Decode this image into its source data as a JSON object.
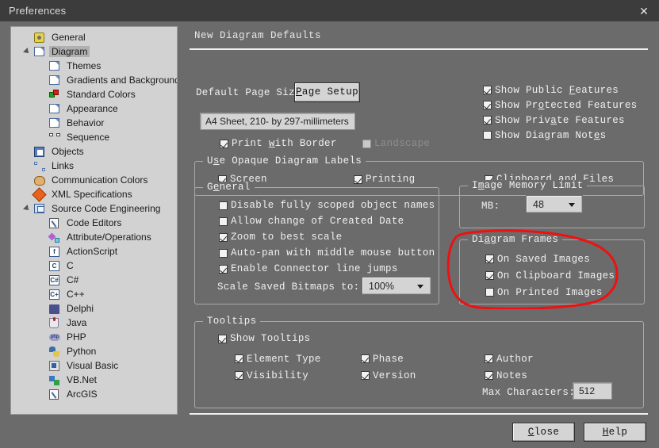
{
  "window": {
    "title": "Preferences",
    "close_icon": "close-icon"
  },
  "sidebar": {
    "items": [
      {
        "label": "General",
        "indent": 0,
        "icon": "gear-icon",
        "selected": false,
        "twisty": "none"
      },
      {
        "label": "Diagram",
        "indent": 0,
        "icon": "document-icon",
        "selected": true,
        "twisty": "open"
      },
      {
        "label": "Themes",
        "indent": 1,
        "icon": "document-icon",
        "selected": false,
        "twisty": "none"
      },
      {
        "label": "Gradients and Background",
        "indent": 1,
        "icon": "document-icon",
        "selected": false,
        "twisty": "none"
      },
      {
        "label": "Standard Colors",
        "indent": 1,
        "icon": "colors-icon",
        "selected": false,
        "twisty": "none"
      },
      {
        "label": "Appearance",
        "indent": 1,
        "icon": "document-icon",
        "selected": false,
        "twisty": "none"
      },
      {
        "label": "Behavior",
        "indent": 1,
        "icon": "document-icon",
        "selected": false,
        "twisty": "none"
      },
      {
        "label": "Sequence",
        "indent": 1,
        "icon": "sequence-icon",
        "selected": false,
        "twisty": "none"
      },
      {
        "label": "Objects",
        "indent": 0,
        "icon": "objects-icon",
        "selected": false,
        "twisty": "none"
      },
      {
        "label": "Links",
        "indent": 0,
        "icon": "links-icon",
        "selected": false,
        "twisty": "none"
      },
      {
        "label": "Communication Colors",
        "indent": 0,
        "icon": "palette-icon",
        "selected": false,
        "twisty": "none"
      },
      {
        "label": "XML Specifications",
        "indent": 0,
        "icon": "xml-icon",
        "selected": false,
        "twisty": "none"
      },
      {
        "label": "Source Code Engineering",
        "indent": 0,
        "icon": "stack-icon",
        "selected": false,
        "twisty": "open"
      },
      {
        "label": "Code Editors",
        "indent": 1,
        "icon": "edit-icon",
        "selected": false,
        "twisty": "none"
      },
      {
        "label": "Attribute/Operations",
        "indent": 1,
        "icon": "attribute-icon",
        "selected": false,
        "twisty": "none"
      },
      {
        "label": "ActionScript",
        "indent": 1,
        "icon": "actionscript-icon",
        "selected": false,
        "twisty": "none"
      },
      {
        "label": "C",
        "indent": 1,
        "icon": "c-icon",
        "selected": false,
        "twisty": "none"
      },
      {
        "label": "C#",
        "indent": 1,
        "icon": "csharp-icon",
        "selected": false,
        "twisty": "none"
      },
      {
        "label": "C++",
        "indent": 1,
        "icon": "cplusplus-icon",
        "selected": false,
        "twisty": "none"
      },
      {
        "label": "Delphi",
        "indent": 1,
        "icon": "delphi-icon",
        "selected": false,
        "twisty": "none"
      },
      {
        "label": "Java",
        "indent": 1,
        "icon": "java-icon",
        "selected": false,
        "twisty": "none"
      },
      {
        "label": "PHP",
        "indent": 1,
        "icon": "php-icon",
        "selected": false,
        "twisty": "none"
      },
      {
        "label": "Python",
        "indent": 1,
        "icon": "python-icon",
        "selected": false,
        "twisty": "none"
      },
      {
        "label": "Visual Basic",
        "indent": 1,
        "icon": "visualbasic-icon",
        "selected": false,
        "twisty": "none"
      },
      {
        "label": "VB.Net",
        "indent": 1,
        "icon": "vbnet-icon",
        "selected": false,
        "twisty": "none"
      },
      {
        "label": "ArcGIS",
        "indent": 1,
        "icon": "arcgis-icon",
        "selected": false,
        "twisty": "none"
      }
    ]
  },
  "panel": {
    "heading": "New Diagram Defaults",
    "page_size_label": "Default Page Size:",
    "page_setup_button": "Page Setup",
    "page_size_value": "A4 Sheet, 210- by 297-millimeters",
    "print_with_border": {
      "label": "Print with Border",
      "checked": true,
      "disabled": false
    },
    "landscape": {
      "label": "Landscape",
      "checked": false,
      "disabled": true
    },
    "show_features": [
      {
        "label": "Show Public Features",
        "checked": true
      },
      {
        "label": "Show Protected Features",
        "checked": true
      },
      {
        "label": "Show Private Features",
        "checked": true
      },
      {
        "label": "Show Diagram Notes",
        "checked": false
      }
    ],
    "opaque_labels": {
      "title": "Use Opaque Diagram Labels",
      "items": [
        {
          "label": "Screen",
          "checked": true
        },
        {
          "label": "Printing",
          "checked": true
        },
        {
          "label": "Clipboard and Files",
          "checked": true
        }
      ]
    },
    "general": {
      "title": "General",
      "items": [
        {
          "label": "Disable fully scoped object names",
          "checked": false
        },
        {
          "label": "Allow change of Created Date",
          "checked": false
        },
        {
          "label": "Zoom to best scale",
          "checked": true
        },
        {
          "label": "Auto-pan with middle mouse button",
          "checked": false
        },
        {
          "label": "Enable Connector line jumps",
          "checked": true
        }
      ],
      "scale_label": "Scale Saved Bitmaps to:",
      "scale_value": "100%"
    },
    "image_memory_limit": {
      "title": "Image Memory Limit",
      "mb_label": "MB:",
      "mb_value": "48"
    },
    "diagram_frames": {
      "title": "Diagram Frames",
      "items": [
        {
          "label": "On Saved Images",
          "checked": true
        },
        {
          "label": "On Clipboard Images",
          "checked": true
        },
        {
          "label": "On Printed Images",
          "checked": false
        }
      ],
      "annotation_color": "#ee1111"
    },
    "tooltips": {
      "title": "Tooltips",
      "show_tooltips": {
        "label": "Show Tooltips",
        "checked": true
      },
      "col1": [
        {
          "label": "Element Type",
          "checked": true
        },
        {
          "label": "Visibility",
          "checked": true
        }
      ],
      "col2": [
        {
          "label": "Phase",
          "checked": true
        },
        {
          "label": "Version",
          "checked": true
        }
      ],
      "col3": [
        {
          "label": "Author",
          "checked": true
        },
        {
          "label": "Notes",
          "checked": true
        }
      ],
      "max_characters_label": "Max Characters:",
      "max_characters_value": "512"
    }
  },
  "footer": {
    "close_button": "Close",
    "help_button": "Help"
  }
}
